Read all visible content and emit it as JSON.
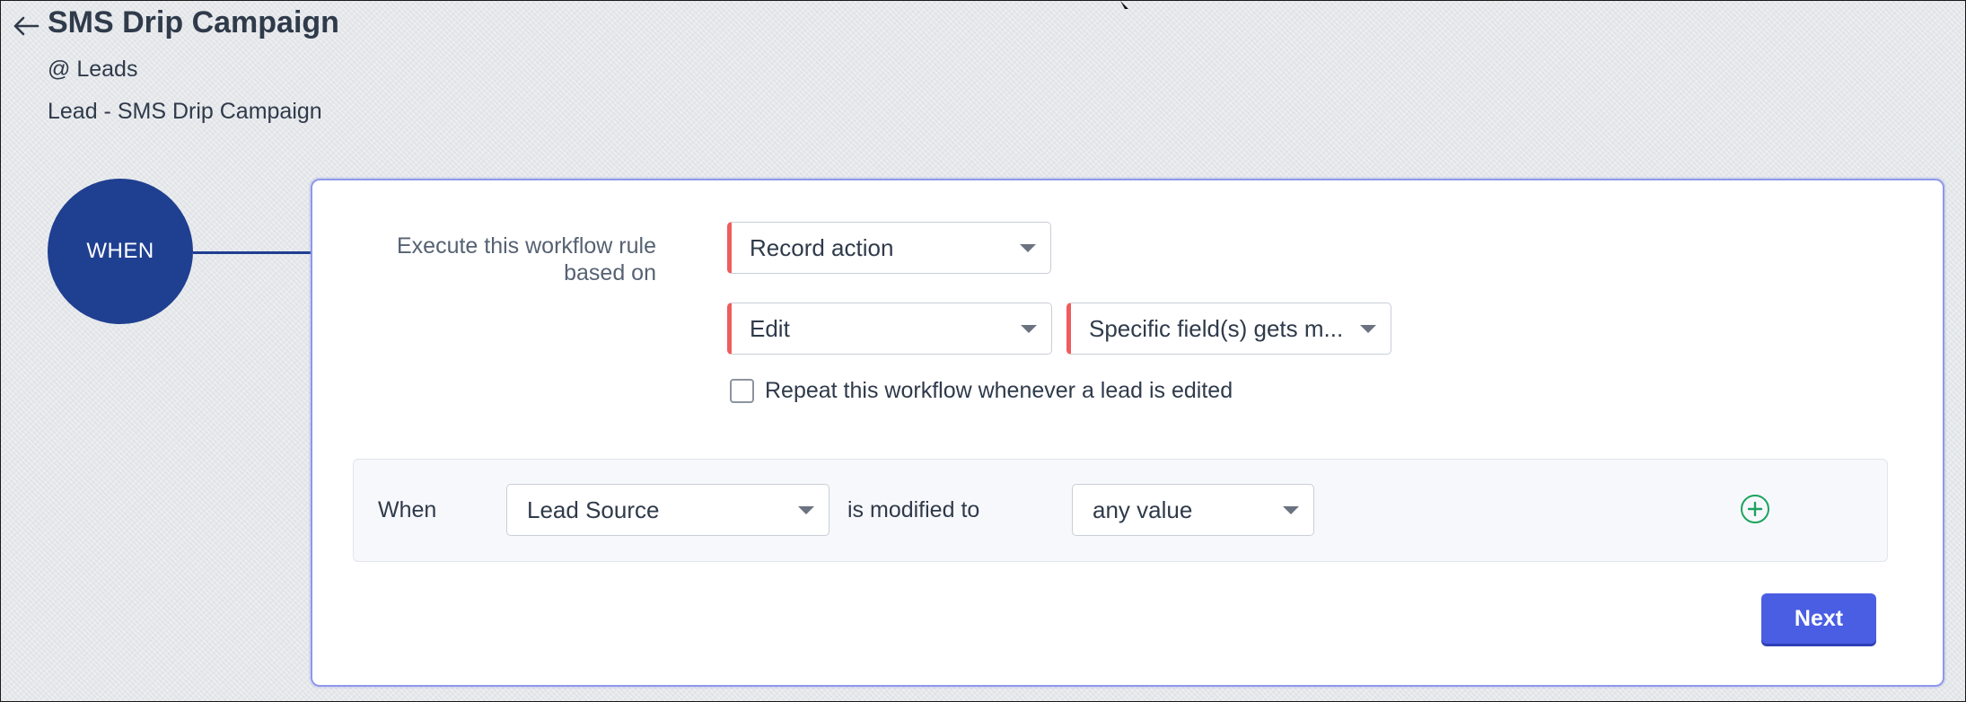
{
  "header": {
    "title": "SMS Drip Campaign",
    "module": "@ Leads",
    "rule_name": "Lead - SMS Drip Campaign"
  },
  "when_node": {
    "label": "WHEN"
  },
  "trigger": {
    "label": "Execute this workflow rule based on",
    "record_action": "Record action",
    "action_type": "Edit",
    "edit_condition": "Specific field(s) gets m...",
    "repeat_label": "Repeat this workflow whenever a lead is edited",
    "repeat_checked": false
  },
  "criteria": {
    "when_label": "When",
    "field": "Lead Source",
    "operator": "is modified to",
    "value": "any value"
  },
  "actions": {
    "next_label": "Next"
  },
  "colors": {
    "node_blue": "#1f3f91",
    "required_marker": "#ef5c5c",
    "primary_button": "#4a5ee4",
    "add_green": "#1ca35e"
  }
}
